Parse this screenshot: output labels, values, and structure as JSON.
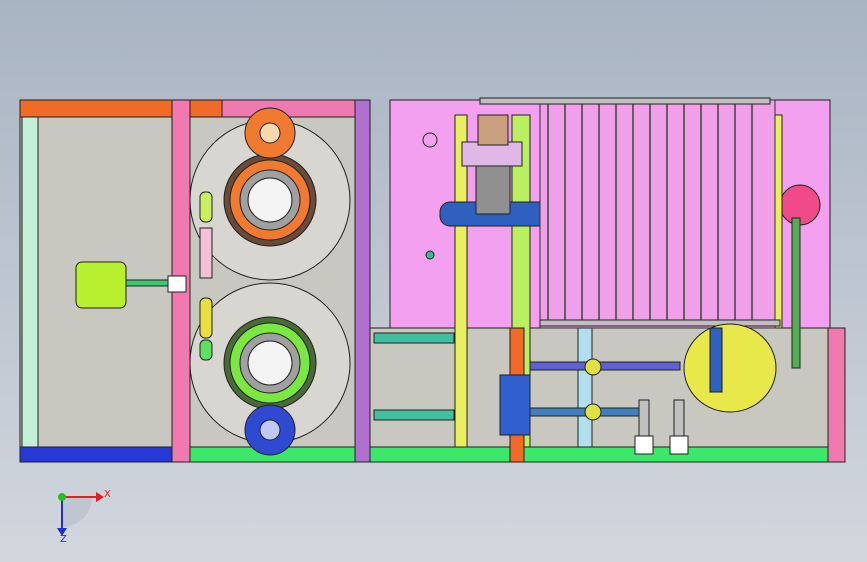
{
  "axes": {
    "x_label": "X",
    "z_label": "Z",
    "x_color": "#e0201a",
    "y_color": "#22c022",
    "z_color": "#1c30d0"
  },
  "colors": {
    "background_top": "#a9b4c3",
    "background_bottom": "#d2d7de",
    "panel_grey": "#c8c8c0",
    "frame_orange": "#f06a28",
    "frame_pink": "#f07ab0",
    "frame_green": "#3ce86a",
    "frame_blue": "#2838d8",
    "module_pink": "#f4a0f0",
    "drum_grey": "#d8d6d0",
    "shaft_blue": "#2f60c0",
    "tank_yellow": "#e8e84a",
    "motor_lime": "#b8f030",
    "purple_rail": "#b070d0",
    "yellow_rail": "#e8f060"
  }
}
